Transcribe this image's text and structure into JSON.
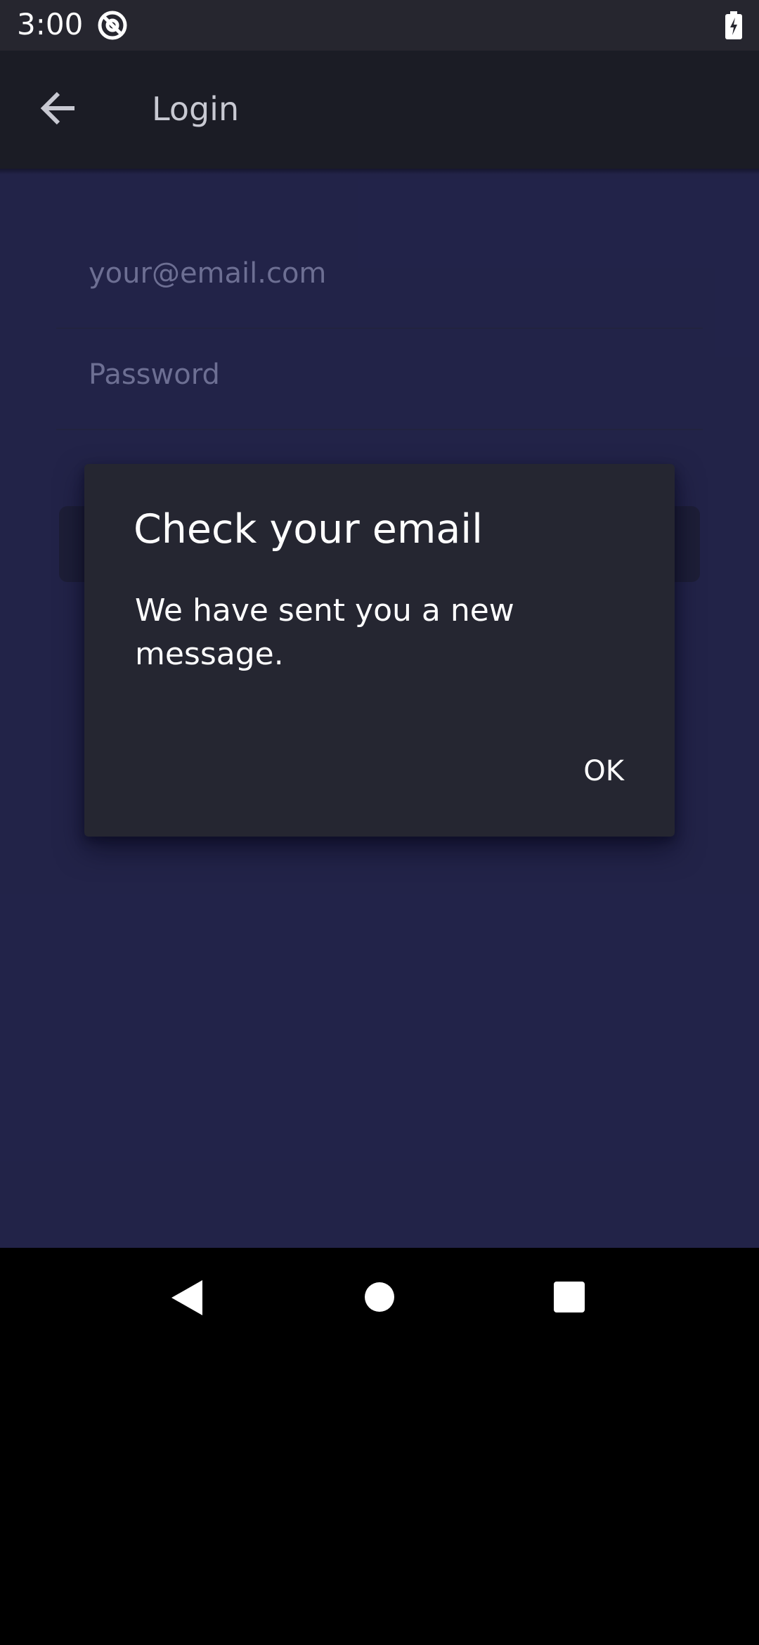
{
  "status_bar": {
    "time": "3:00",
    "app_icon": "at-sign-icon",
    "battery_icon": "battery-charging-icon"
  },
  "app_bar": {
    "back_icon": "arrow-left-icon",
    "title": "Login"
  },
  "form": {
    "email_placeholder": "your@email.com",
    "password_placeholder": "Password"
  },
  "dialog": {
    "title": "Check your email",
    "message": "We have sent you a new message.",
    "ok_label": "OK"
  },
  "nav_bar": {
    "back_icon": "nav-back-icon",
    "home_icon": "nav-home-icon",
    "recents_icon": "nav-recents-icon"
  },
  "colors": {
    "status_bar": "#26262f",
    "app_bar": "#1b1c25",
    "content_background": "#272850",
    "dialog_background": "#252631",
    "placeholder_text": "#6d6f93"
  }
}
